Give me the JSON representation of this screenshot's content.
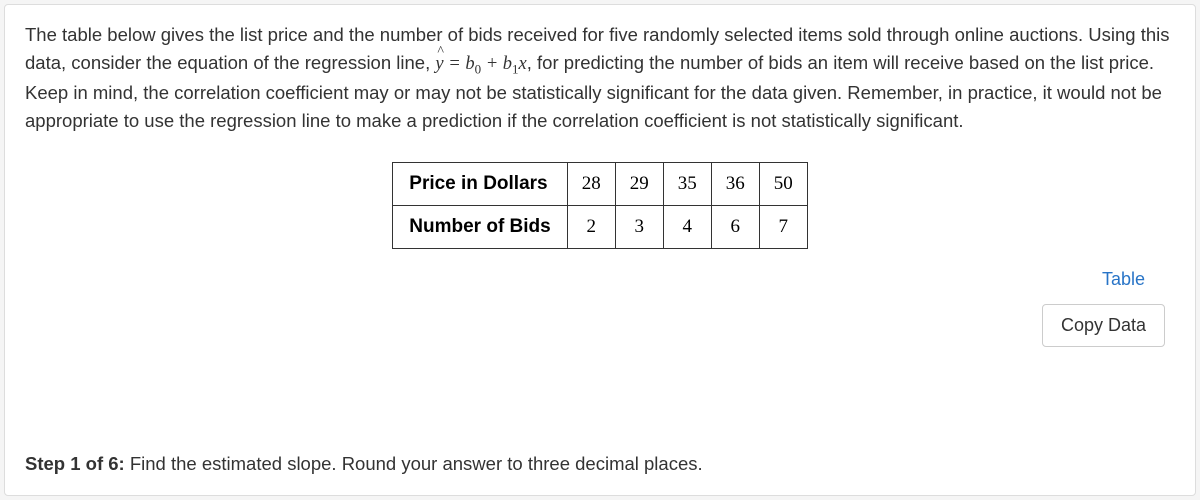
{
  "problem": {
    "text_before": "The table below gives the list price and the number of bids received for five randomly selected items sold through online auctions. Using this data, consider the equation of the regression line, ",
    "text_after": ", for predicting the number of bids an item will receive based on the list price. Keep in mind, the correlation coefficient may or may not be statistically significant for the data given. Remember, in practice, it would not be appropriate to use the regression line to make a prediction if the correlation coefficient is not statistically significant."
  },
  "chart_data": {
    "type": "table",
    "rows": [
      {
        "header": "Price in Dollars",
        "values": [
          "28",
          "29",
          "35",
          "36",
          "50"
        ]
      },
      {
        "header": "Number of Bids",
        "values": [
          "2",
          "3",
          "4",
          "6",
          "7"
        ]
      }
    ]
  },
  "actions": {
    "table_link": "Table",
    "copy_button": "Copy Data"
  },
  "step": {
    "label": "Step 1 of 6:",
    "instruction": " Find the estimated slope. Round your answer to three decimal places."
  }
}
